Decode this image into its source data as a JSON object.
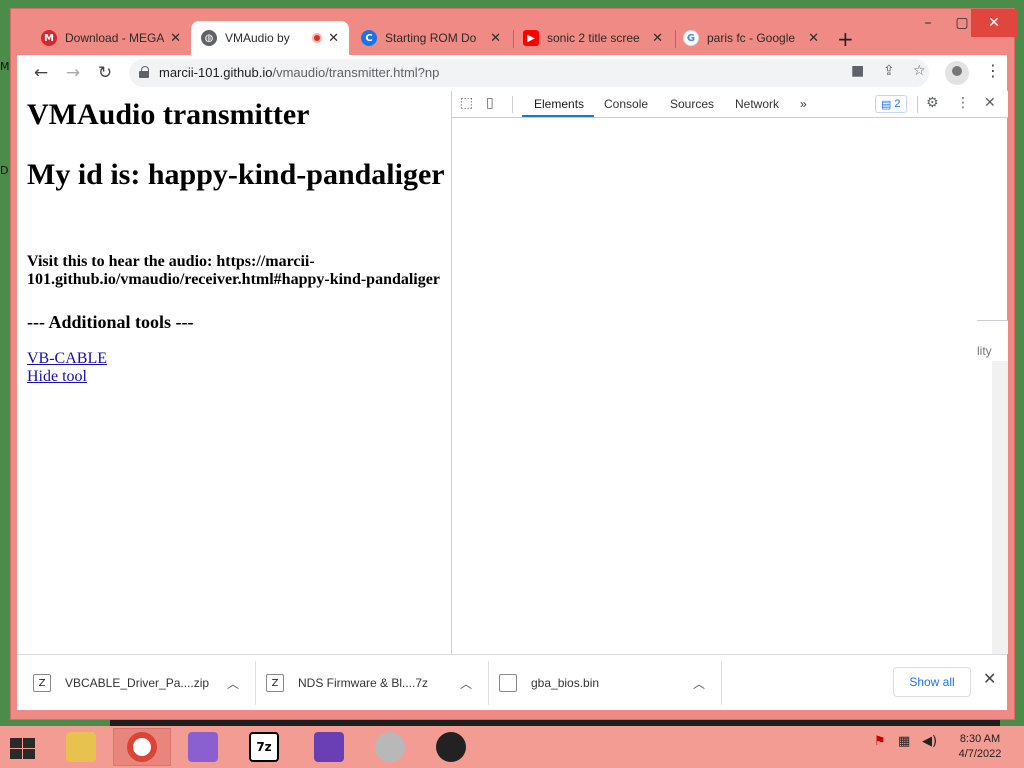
{
  "desktop": {
    "glyphs": [
      "M",
      "D"
    ]
  },
  "window_controls": {
    "minimize": "–",
    "maximize": "▢",
    "close": "✕"
  },
  "tabs": [
    {
      "title": "Download - MEGA",
      "favicon": "mega-icon",
      "favicon_color": "#d9272e",
      "favicon_glyph": "M"
    },
    {
      "title": "VMAudio by",
      "favicon": "globe-icon",
      "favicon_color": "#5f6368",
      "favicon_glyph": "🌐",
      "recording": true
    },
    {
      "title": "Starting ROM Do",
      "favicon": "c-icon",
      "favicon_color": "#1a73e8",
      "favicon_glyph": "C"
    },
    {
      "title": "sonic 2 title scree",
      "favicon": "youtube-icon",
      "favicon_color": "#ff0000",
      "favicon_glyph": "▶"
    },
    {
      "title": "paris fc - Google",
      "favicon": "google-icon",
      "favicon_color": "#4285f4",
      "favicon_glyph": "G"
    }
  ],
  "toolbar": {
    "url_host": "marcii-101.github.io",
    "url_path": "/vmaudio/transmitter.html?np"
  },
  "page": {
    "heading": "VMAudio transmitter",
    "id_heading": "My id is: happy-kind-pandaliger",
    "visit_text": "Visit this to hear the audio: https://marcii-101.github.io/vmaudio/receiver.html#happy-kind-pandaliger",
    "tools_heading": "--- Additional tools ---",
    "link_vbcable": "VB-CABLE",
    "link_hide": "Hide tool"
  },
  "devtools": {
    "tabs": [
      "Elements",
      "Console",
      "Sources",
      "Network"
    ],
    "more": "»",
    "issues_count": "2",
    "side_label": "lity"
  },
  "downloads": [
    {
      "name": "VBCABLE_Driver_Pa....zip",
      "icon": "zip-archive-icon"
    },
    {
      "name": "NDS Firmware & Bl....7z",
      "icon": "7z-archive-icon"
    },
    {
      "name": "gba_bios.bin",
      "icon": "file-icon"
    }
  ],
  "shelf": {
    "show_all": "Show all"
  },
  "taskbar": {
    "apps": [
      "file-explorer-icon",
      "chrome-icon",
      "app-icon",
      "7zip-icon",
      "cat-app-icon",
      "speaker-app-icon",
      "person-app-icon"
    ],
    "time": "8:30 AM",
    "date": "4/7/2022"
  }
}
